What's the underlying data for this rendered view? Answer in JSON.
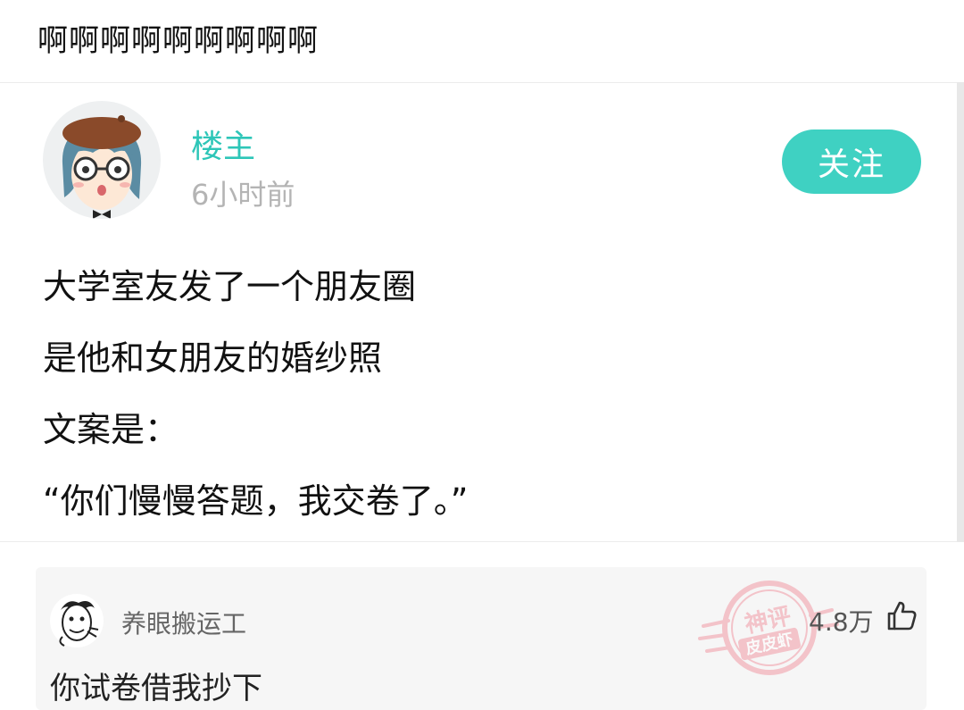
{
  "header": {
    "caption": "啊啊啊啊啊啊啊啊啊"
  },
  "post": {
    "author": "楼主",
    "time": "6小时前",
    "follow_label": "关注",
    "lines": [
      "大学室友发了一个朋友圈",
      "是他和女朋友的婚纱照",
      "文案是：",
      "“你们慢慢答题，我交卷了。”"
    ]
  },
  "comment": {
    "username": "养眼搬运工",
    "text": "你试卷借我抄下",
    "likes": "4.8万",
    "stamp_line1": "神评",
    "stamp_line2": "皮皮虾"
  },
  "colors": {
    "accent": "#3fd1c2",
    "author_name": "#2ec6b8",
    "stamp": "#f19aa6"
  },
  "icons": {
    "like": "thumbs-up-icon",
    "stamp": "hot-comment-stamp-icon"
  }
}
